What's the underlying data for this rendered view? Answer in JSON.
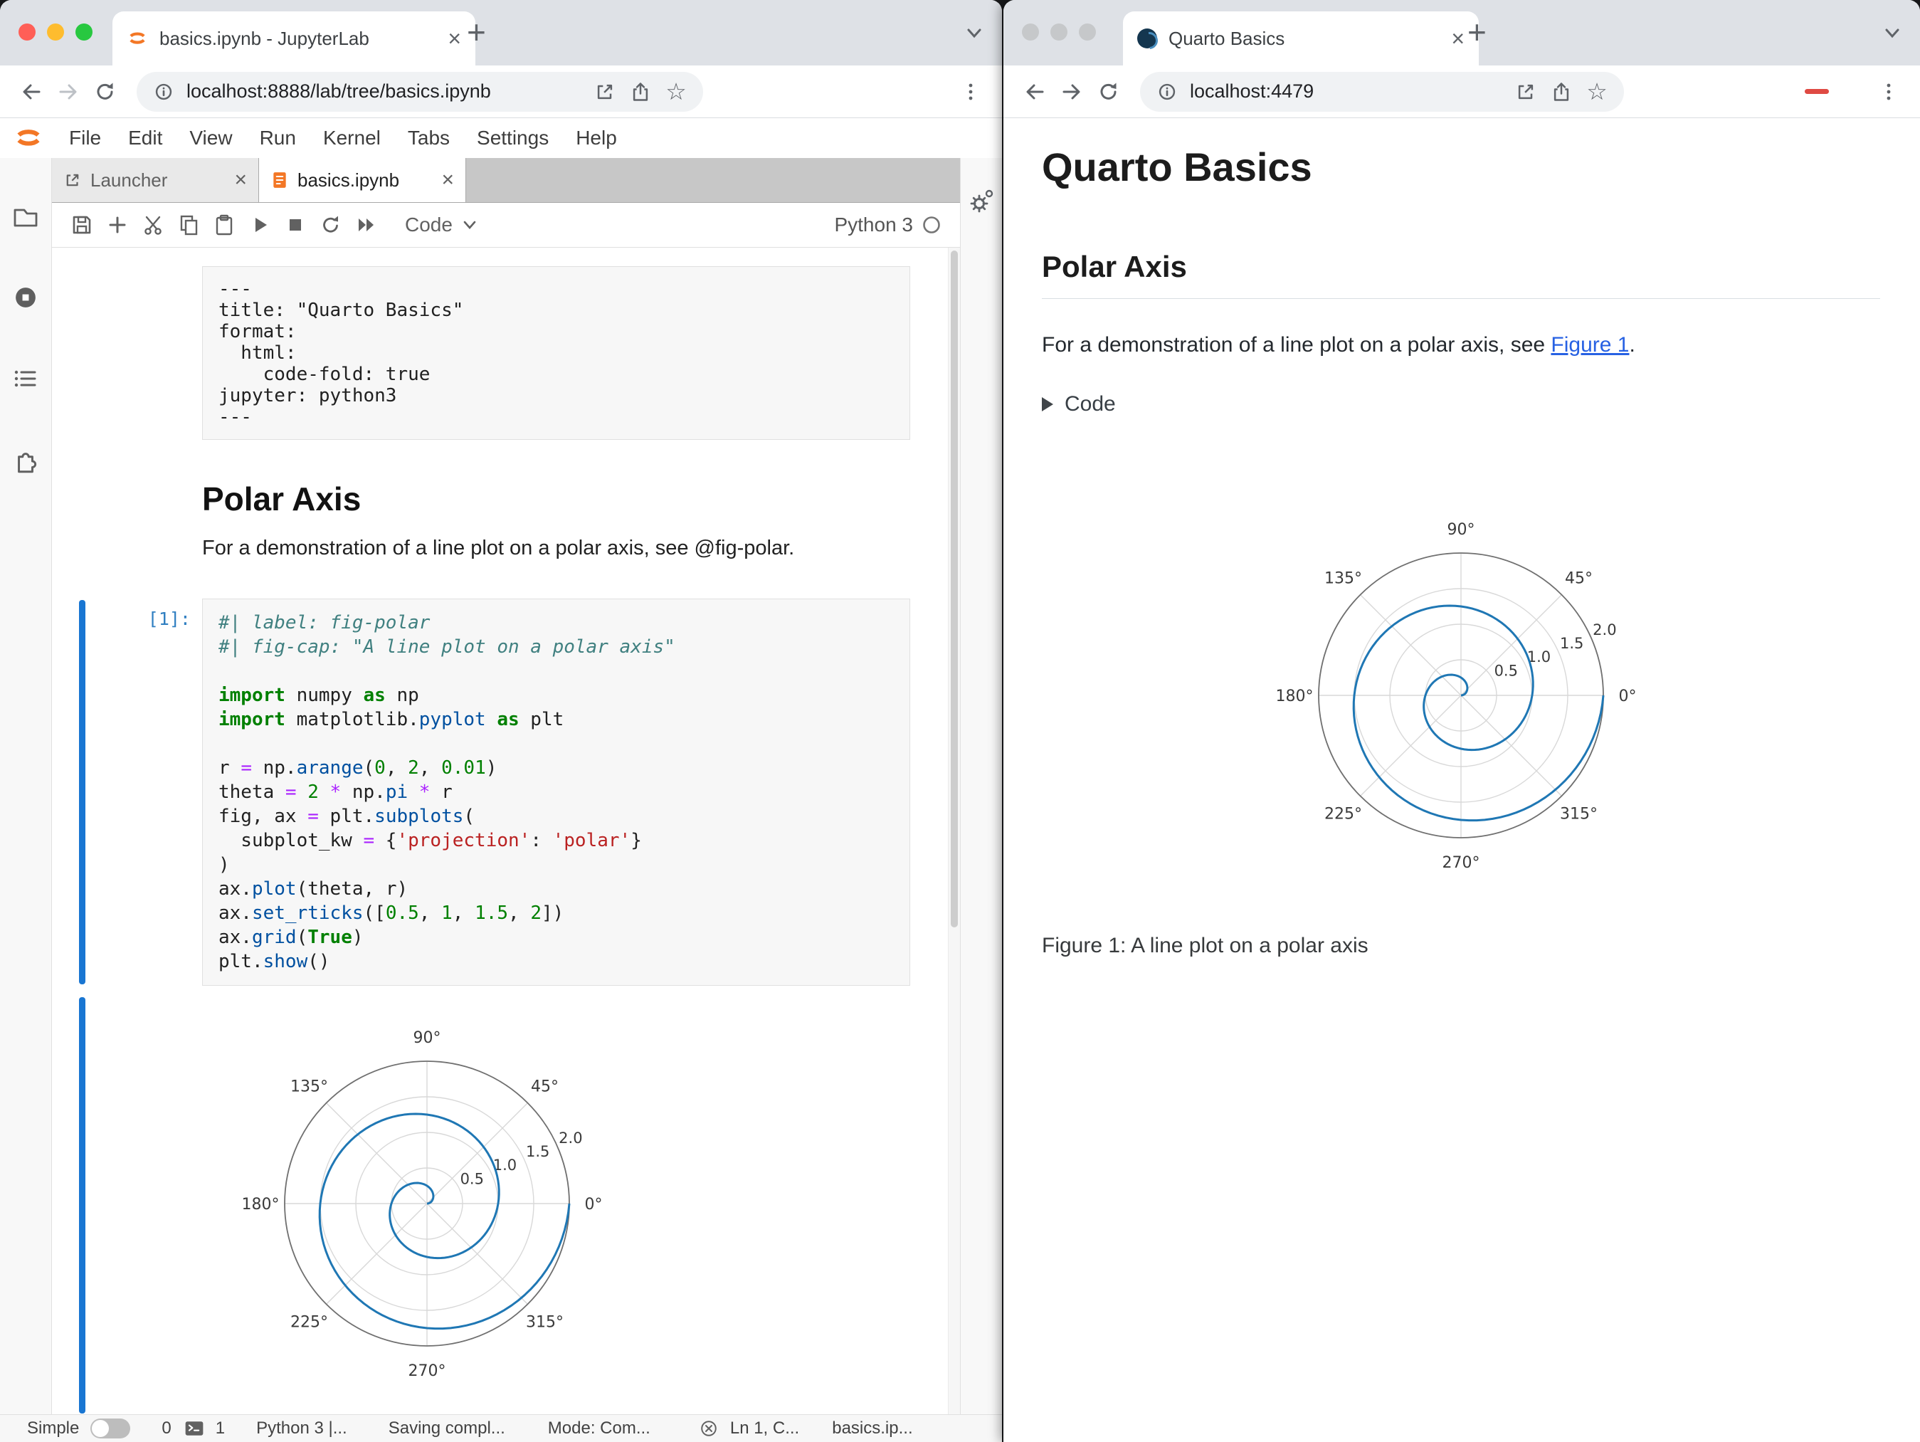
{
  "colors": {
    "accent_blue": "#1976d2",
    "jupyter_orange": "#f37726",
    "spiral_line": "#1f77b4",
    "link_blue": "#2761e3"
  },
  "icons": {
    "star": "☆",
    "close": "×",
    "new_tab": "+"
  },
  "left_window": {
    "browser": {
      "tab_title": "basics.ipynb - JupyterLab",
      "url": "localhost:8888/lab/tree/basics.ipynb"
    },
    "menubar": {
      "items": [
        "File",
        "Edit",
        "View",
        "Run",
        "Kernel",
        "Tabs",
        "Settings",
        "Help"
      ]
    },
    "doc_tabs": {
      "launcher": "Launcher",
      "notebook": "basics.ipynb"
    },
    "nb_toolbar": {
      "cell_type": "Code",
      "kernel": "Python 3"
    },
    "notebook": {
      "raw_cell_lines": [
        "---",
        "title: \"Quarto Basics\"",
        "format:",
        "  html:",
        "    code-fold: true",
        "jupyter: python3",
        "---"
      ],
      "markdown": {
        "heading": "Polar Axis",
        "paragraph": "For a demonstration of a line plot on a polar axis, see @fig-polar."
      },
      "code_cell": {
        "prompt": "[1]:",
        "lines": [
          [
            {
              "c": "com",
              "t": "#| label: fig-polar"
            }
          ],
          [
            {
              "c": "com",
              "t": "#| fig-cap: \"A line plot on a polar axis\""
            }
          ],
          [],
          [
            {
              "c": "kw",
              "t": "import"
            },
            {
              "c": "pl",
              "t": " numpy "
            },
            {
              "c": "kw",
              "t": "as"
            },
            {
              "c": "pl",
              "t": " np"
            }
          ],
          [
            {
              "c": "kw",
              "t": "import"
            },
            {
              "c": "pl",
              "t": " matplotlib."
            },
            {
              "c": "prop",
              "t": "pyplot"
            },
            {
              "c": "pl",
              "t": " "
            },
            {
              "c": "kw",
              "t": "as"
            },
            {
              "c": "pl",
              "t": " plt"
            }
          ],
          [],
          [
            {
              "c": "pl",
              "t": "r "
            },
            {
              "c": "op",
              "t": "="
            },
            {
              "c": "pl",
              "t": " np."
            },
            {
              "c": "prop",
              "t": "arange"
            },
            {
              "c": "pl",
              "t": "("
            },
            {
              "c": "num",
              "t": "0"
            },
            {
              "c": "pl",
              "t": ", "
            },
            {
              "c": "num",
              "t": "2"
            },
            {
              "c": "pl",
              "t": ", "
            },
            {
              "c": "num",
              "t": "0.01"
            },
            {
              "c": "pl",
              "t": ")"
            }
          ],
          [
            {
              "c": "pl",
              "t": "theta "
            },
            {
              "c": "op",
              "t": "="
            },
            {
              "c": "pl",
              "t": " "
            },
            {
              "c": "num",
              "t": "2"
            },
            {
              "c": "pl",
              "t": " "
            },
            {
              "c": "op",
              "t": "*"
            },
            {
              "c": "pl",
              "t": " np."
            },
            {
              "c": "prop",
              "t": "pi"
            },
            {
              "c": "pl",
              "t": " "
            },
            {
              "c": "op",
              "t": "*"
            },
            {
              "c": "pl",
              "t": " r"
            }
          ],
          [
            {
              "c": "pl",
              "t": "fig, ax "
            },
            {
              "c": "op",
              "t": "="
            },
            {
              "c": "pl",
              "t": " plt."
            },
            {
              "c": "prop",
              "t": "subplots"
            },
            {
              "c": "pl",
              "t": "("
            }
          ],
          [
            {
              "c": "pl",
              "t": "  subplot_kw "
            },
            {
              "c": "op",
              "t": "="
            },
            {
              "c": "pl",
              "t": " {"
            },
            {
              "c": "str",
              "t": "'projection'"
            },
            {
              "c": "pl",
              "t": ": "
            },
            {
              "c": "str",
              "t": "'polar'"
            },
            {
              "c": "pl",
              "t": "}"
            }
          ],
          [
            {
              "c": "pl",
              "t": ")"
            }
          ],
          [
            {
              "c": "pl",
              "t": "ax."
            },
            {
              "c": "prop",
              "t": "plot"
            },
            {
              "c": "pl",
              "t": "(theta, r)"
            }
          ],
          [
            {
              "c": "pl",
              "t": "ax."
            },
            {
              "c": "prop",
              "t": "set_rticks"
            },
            {
              "c": "pl",
              "t": "(["
            },
            {
              "c": "num",
              "t": "0.5"
            },
            {
              "c": "pl",
              "t": ", "
            },
            {
              "c": "num",
              "t": "1"
            },
            {
              "c": "pl",
              "t": ", "
            },
            {
              "c": "num",
              "t": "1.5"
            },
            {
              "c": "pl",
              "t": ", "
            },
            {
              "c": "num",
              "t": "2"
            },
            {
              "c": "pl",
              "t": "])"
            }
          ],
          [
            {
              "c": "pl",
              "t": "ax."
            },
            {
              "c": "prop",
              "t": "grid"
            },
            {
              "c": "pl",
              "t": "("
            },
            {
              "c": "kw",
              "t": "True"
            },
            {
              "c": "pl",
              "t": ")"
            }
          ],
          [
            {
              "c": "pl",
              "t": "plt."
            },
            {
              "c": "prop",
              "t": "show"
            },
            {
              "c": "pl",
              "t": "()"
            }
          ]
        ]
      }
    },
    "statusbar": {
      "simple_label": "Simple",
      "kernels_count": "0",
      "terminals_count": "1",
      "kernel_status": "Python 3 |...",
      "saving": "Saving compl...",
      "mode": "Mode: Com...",
      "position": "Ln 1, C...",
      "filename": "basics.ip..."
    }
  },
  "right_window": {
    "browser": {
      "tab_title": "Quarto Basics",
      "url": "localhost:4479"
    },
    "page": {
      "title": "Quarto Basics",
      "section": "Polar Axis",
      "paragraph_prefix": "For a demonstration of a line plot on a polar axis, see ",
      "link_text": "Figure 1",
      "paragraph_suffix": ".",
      "code_toggle": "Code",
      "caption": "Figure 1: A line plot on a polar axis"
    }
  },
  "chart_data": {
    "type": "line",
    "projection": "polar",
    "description": "Archimedean spiral: theta = 2*pi*r for r in [0,2] step 0.01, plotted twice (notebook output and rendered Quarto page)",
    "r_range": [
      0,
      2
    ],
    "r_step": 0.01,
    "theta_formula": "theta = 2 * pi * r",
    "rticks": [
      0.5,
      1.0,
      1.5,
      2.0
    ],
    "rtick_labels": [
      "0.5",
      "1.0",
      "1.5",
      "2.0"
    ],
    "theta_ticks_deg": [
      0,
      45,
      90,
      135,
      180,
      225,
      270,
      315
    ],
    "theta_tick_labels": [
      "0°",
      "45°",
      "90°",
      "135°",
      "180°",
      "225°",
      "270°",
      "315°"
    ],
    "rlabel_angle_deg": 22.5,
    "grid": true,
    "line_color": "#1f77b4"
  }
}
